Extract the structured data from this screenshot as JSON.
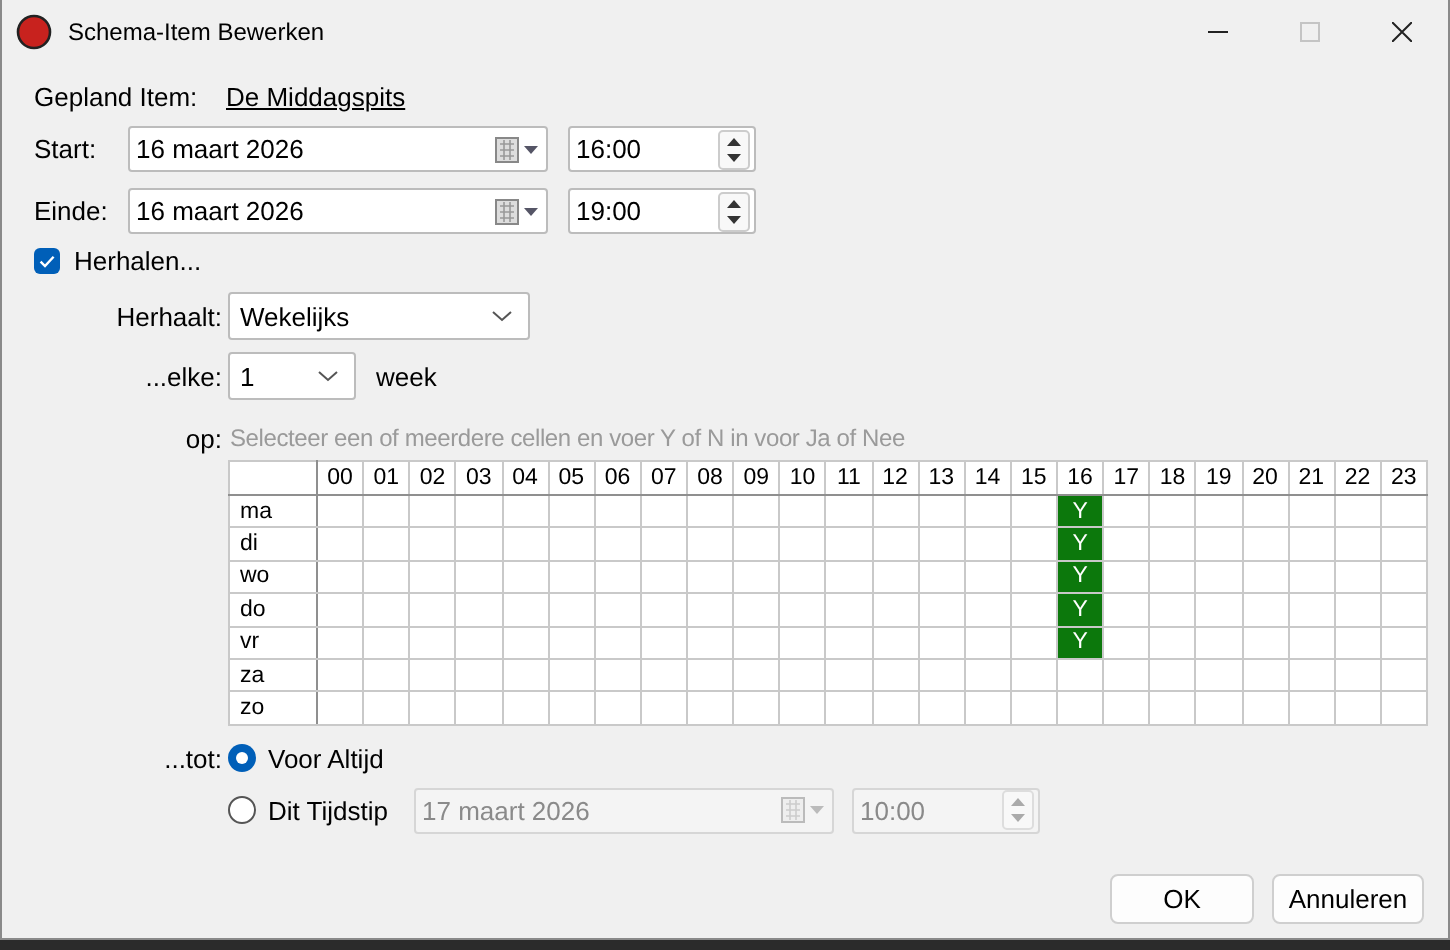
{
  "window": {
    "title": "Schema-Item Bewerken",
    "maximize_disabled": true
  },
  "planned_item": {
    "label": "Gepland Item:",
    "value": "De Middagspits"
  },
  "start": {
    "label": "Start:",
    "date": "16 maart 2026",
    "time": "16:00"
  },
  "end": {
    "label": "Einde:",
    "date": "16 maart 2026",
    "time": "19:00"
  },
  "repeat": {
    "label": "Herhalen...",
    "checked": true
  },
  "frequency": {
    "label": "Herhaalt:",
    "value": "Wekelijks"
  },
  "every": {
    "label": "...elke:",
    "value": "1",
    "unit": "week"
  },
  "on": {
    "label": "op:",
    "hint": "Selecteer een of meerdere cellen en voer Y of N in voor Ja of Nee",
    "grid": {
      "hours": [
        "00",
        "01",
        "02",
        "03",
        "04",
        "05",
        "06",
        "07",
        "08",
        "09",
        "10",
        "11",
        "12",
        "13",
        "14",
        "15",
        "16",
        "17",
        "18",
        "19",
        "20",
        "21",
        "22",
        "23"
      ],
      "rows": [
        {
          "day": "ma",
          "cells": [
            {
              "selected": false
            },
            {
              "selected": false
            },
            {
              "selected": false
            },
            {
              "selected": false
            },
            {
              "selected": false
            },
            {
              "selected": false
            },
            {
              "selected": false
            },
            {
              "selected": false
            },
            {
              "selected": false
            },
            {
              "selected": false
            },
            {
              "selected": false
            },
            {
              "selected": false
            },
            {
              "selected": false
            },
            {
              "selected": false
            },
            {
              "selected": false
            },
            {
              "selected": false
            },
            {
              "selected": true,
              "value": "Y"
            },
            {
              "selected": false
            },
            {
              "selected": false
            },
            {
              "selected": false
            },
            {
              "selected": false
            },
            {
              "selected": false
            },
            {
              "selected": false
            },
            {
              "selected": false
            }
          ]
        },
        {
          "day": "di",
          "cells": [
            {
              "selected": false
            },
            {
              "selected": false
            },
            {
              "selected": false
            },
            {
              "selected": false
            },
            {
              "selected": false
            },
            {
              "selected": false
            },
            {
              "selected": false
            },
            {
              "selected": false
            },
            {
              "selected": false
            },
            {
              "selected": false
            },
            {
              "selected": false
            },
            {
              "selected": false
            },
            {
              "selected": false
            },
            {
              "selected": false
            },
            {
              "selected": false
            },
            {
              "selected": false
            },
            {
              "selected": true,
              "value": "Y"
            },
            {
              "selected": false
            },
            {
              "selected": false
            },
            {
              "selected": false
            },
            {
              "selected": false
            },
            {
              "selected": false
            },
            {
              "selected": false
            },
            {
              "selected": false
            }
          ]
        },
        {
          "day": "wo",
          "cells": [
            {
              "selected": false
            },
            {
              "selected": false
            },
            {
              "selected": false
            },
            {
              "selected": false
            },
            {
              "selected": false
            },
            {
              "selected": false
            },
            {
              "selected": false
            },
            {
              "selected": false
            },
            {
              "selected": false
            },
            {
              "selected": false
            },
            {
              "selected": false
            },
            {
              "selected": false
            },
            {
              "selected": false
            },
            {
              "selected": false
            },
            {
              "selected": false
            },
            {
              "selected": false
            },
            {
              "selected": true,
              "value": "Y"
            },
            {
              "selected": false
            },
            {
              "selected": false
            },
            {
              "selected": false
            },
            {
              "selected": false
            },
            {
              "selected": false
            },
            {
              "selected": false
            },
            {
              "selected": false
            }
          ]
        },
        {
          "day": "do",
          "cells": [
            {
              "selected": false
            },
            {
              "selected": false
            },
            {
              "selected": false
            },
            {
              "selected": false
            },
            {
              "selected": false
            },
            {
              "selected": false
            },
            {
              "selected": false
            },
            {
              "selected": false
            },
            {
              "selected": false
            },
            {
              "selected": false
            },
            {
              "selected": false
            },
            {
              "selected": false
            },
            {
              "selected": false
            },
            {
              "selected": false
            },
            {
              "selected": false
            },
            {
              "selected": false
            },
            {
              "selected": true,
              "value": "Y"
            },
            {
              "selected": false
            },
            {
              "selected": false
            },
            {
              "selected": false
            },
            {
              "selected": false
            },
            {
              "selected": false
            },
            {
              "selected": false
            },
            {
              "selected": false
            }
          ]
        },
        {
          "day": "vr",
          "cells": [
            {
              "selected": false
            },
            {
              "selected": false
            },
            {
              "selected": false
            },
            {
              "selected": false
            },
            {
              "selected": false
            },
            {
              "selected": false
            },
            {
              "selected": false
            },
            {
              "selected": false
            },
            {
              "selected": false
            },
            {
              "selected": false
            },
            {
              "selected": false
            },
            {
              "selected": false
            },
            {
              "selected": false
            },
            {
              "selected": false
            },
            {
              "selected": false
            },
            {
              "selected": false
            },
            {
              "selected": true,
              "value": "Y"
            },
            {
              "selected": false
            },
            {
              "selected": false
            },
            {
              "selected": false
            },
            {
              "selected": false
            },
            {
              "selected": false
            },
            {
              "selected": false
            },
            {
              "selected": false
            }
          ]
        },
        {
          "day": "za",
          "cells": [
            {
              "selected": false
            },
            {
              "selected": false
            },
            {
              "selected": false
            },
            {
              "selected": false
            },
            {
              "selected": false
            },
            {
              "selected": false
            },
            {
              "selected": false
            },
            {
              "selected": false
            },
            {
              "selected": false
            },
            {
              "selected": false
            },
            {
              "selected": false
            },
            {
              "selected": false
            },
            {
              "selected": false
            },
            {
              "selected": false
            },
            {
              "selected": false
            },
            {
              "selected": false
            },
            {
              "selected": false
            },
            {
              "selected": false
            },
            {
              "selected": false
            },
            {
              "selected": false
            },
            {
              "selected": false
            },
            {
              "selected": false
            },
            {
              "selected": false
            },
            {
              "selected": false
            }
          ]
        },
        {
          "day": "zo",
          "cells": [
            {
              "selected": false
            },
            {
              "selected": false
            },
            {
              "selected": false
            },
            {
              "selected": false
            },
            {
              "selected": false
            },
            {
              "selected": false
            },
            {
              "selected": false
            },
            {
              "selected": false
            },
            {
              "selected": false
            },
            {
              "selected": false
            },
            {
              "selected": false
            },
            {
              "selected": false
            },
            {
              "selected": false
            },
            {
              "selected": false
            },
            {
              "selected": false
            },
            {
              "selected": false
            },
            {
              "selected": false
            },
            {
              "selected": false
            },
            {
              "selected": false
            },
            {
              "selected": false
            },
            {
              "selected": false
            },
            {
              "selected": false
            },
            {
              "selected": false
            },
            {
              "selected": false
            }
          ]
        }
      ]
    }
  },
  "until": {
    "label": "...tot:",
    "options": [
      {
        "label": "Voor Altijd",
        "selected": true
      },
      {
        "label": "Dit Tijdstip",
        "selected": false,
        "disabled": true,
        "date": "17 maart 2026",
        "time": "10:00"
      }
    ]
  },
  "buttons": [
    {
      "label": "OK"
    },
    {
      "label": "Annuleren"
    }
  ]
}
